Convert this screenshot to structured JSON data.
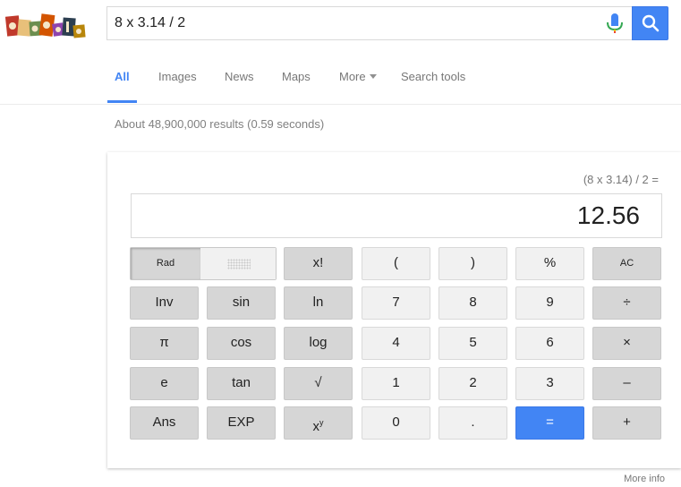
{
  "search": {
    "query": "8 x 3.14 / 2"
  },
  "tabs": [
    {
      "label": "All"
    },
    {
      "label": "Images"
    },
    {
      "label": "News"
    },
    {
      "label": "Maps"
    },
    {
      "label": "More"
    },
    {
      "label": "Search tools"
    }
  ],
  "result_stats": "About 48,900,000 results (0.59 seconds)",
  "calculator": {
    "expression": "(8 x 3.14) / 2 =",
    "result": "12.56",
    "keys": {
      "rad": "Rad",
      "fact": "x!",
      "lparen": "(",
      "rparen": ")",
      "percent": "%",
      "ac": "AC",
      "inv": "Inv",
      "sin": "sin",
      "ln": "ln",
      "seven": "7",
      "eight": "8",
      "nine": "9",
      "divide": "÷",
      "pi": "π",
      "cos": "cos",
      "log": "log",
      "four": "4",
      "five": "5",
      "six": "6",
      "multiply": "×",
      "e": "e",
      "tan": "tan",
      "sqrt": "√",
      "one": "1",
      "two": "2",
      "three": "3",
      "minus": "–",
      "ans": "Ans",
      "exp": "EXP",
      "zero": "0",
      "dot": ".",
      "equals": "=",
      "plus": "+"
    }
  },
  "more_info": "More info",
  "colors": {
    "accent": "#4285f4",
    "key_dark": "#d6d6d6",
    "key_light": "#f1f1f1"
  }
}
